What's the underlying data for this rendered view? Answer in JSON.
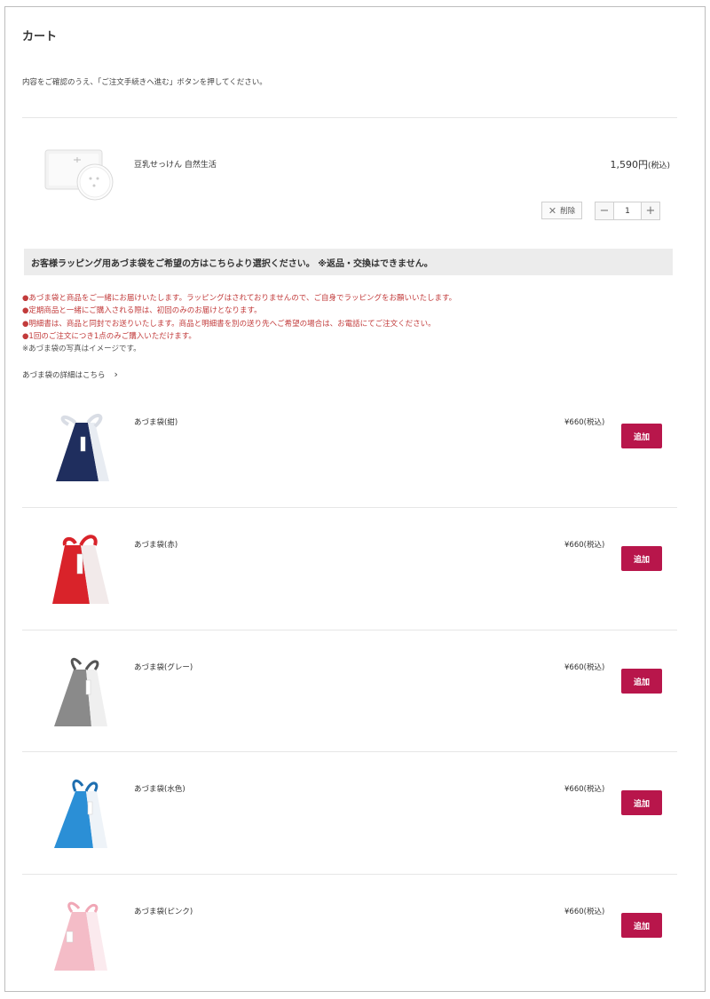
{
  "page": {
    "title": "カート",
    "intro": "内容をご確認のうえ、「ご注文手続きへ進む」ボタンを押してください。"
  },
  "cart_item": {
    "name": "豆乳せっけん 自然生活",
    "price": "1,590円",
    "tax": "(税込)",
    "delete_label": "削除",
    "quantity": "1",
    "minus": "−",
    "plus": "+"
  },
  "wrapping": {
    "banner": "お客様ラッピング用あづま袋をご希望の方はこちらより選択ください。 ※返品・交換はできません。",
    "notes": [
      "●あづま袋と商品をご一緒にお届けいたします。ラッピングはされておりませんので、ご自身でラッピングをお願いいたします。",
      "●定期商品と一緒にご購入される際は、初回のみのお届けとなります。",
      "●明細書は、商品と同封でお送りいたします。商品と明細書を別の送り先へご希望の場合は、お電話にてご注文ください。",
      "●1回のご注文につき1点のみご購入いただけます。"
    ],
    "photo_note": "※あづま袋の写真はイメージです。",
    "detail_link": "あづま袋の詳細はこちら",
    "chevron": "›"
  },
  "bags": [
    {
      "name": "あづま袋(紺)",
      "price": "¥660(税込)",
      "add_label": "追加",
      "color": "#1f2e5e"
    },
    {
      "name": "あづま袋(赤)",
      "price": "¥660(税込)",
      "add_label": "追加",
      "color": "#d9232a"
    },
    {
      "name": "あづま袋(グレー)",
      "price": "¥660(税込)",
      "add_label": "追加",
      "color": "#8a8a8a"
    },
    {
      "name": "あづま袋(水色)",
      "price": "¥660(税込)",
      "add_label": "追加",
      "color": "#2b8fd6"
    },
    {
      "name": "あづま袋(ピンク)",
      "price": "¥660(税込)",
      "add_label": "追加",
      "color": "#f4bcc7"
    }
  ],
  "colors": {
    "accent": "#b8164b",
    "note_red": "#c23b3b",
    "banner_bg": "#ececec"
  }
}
